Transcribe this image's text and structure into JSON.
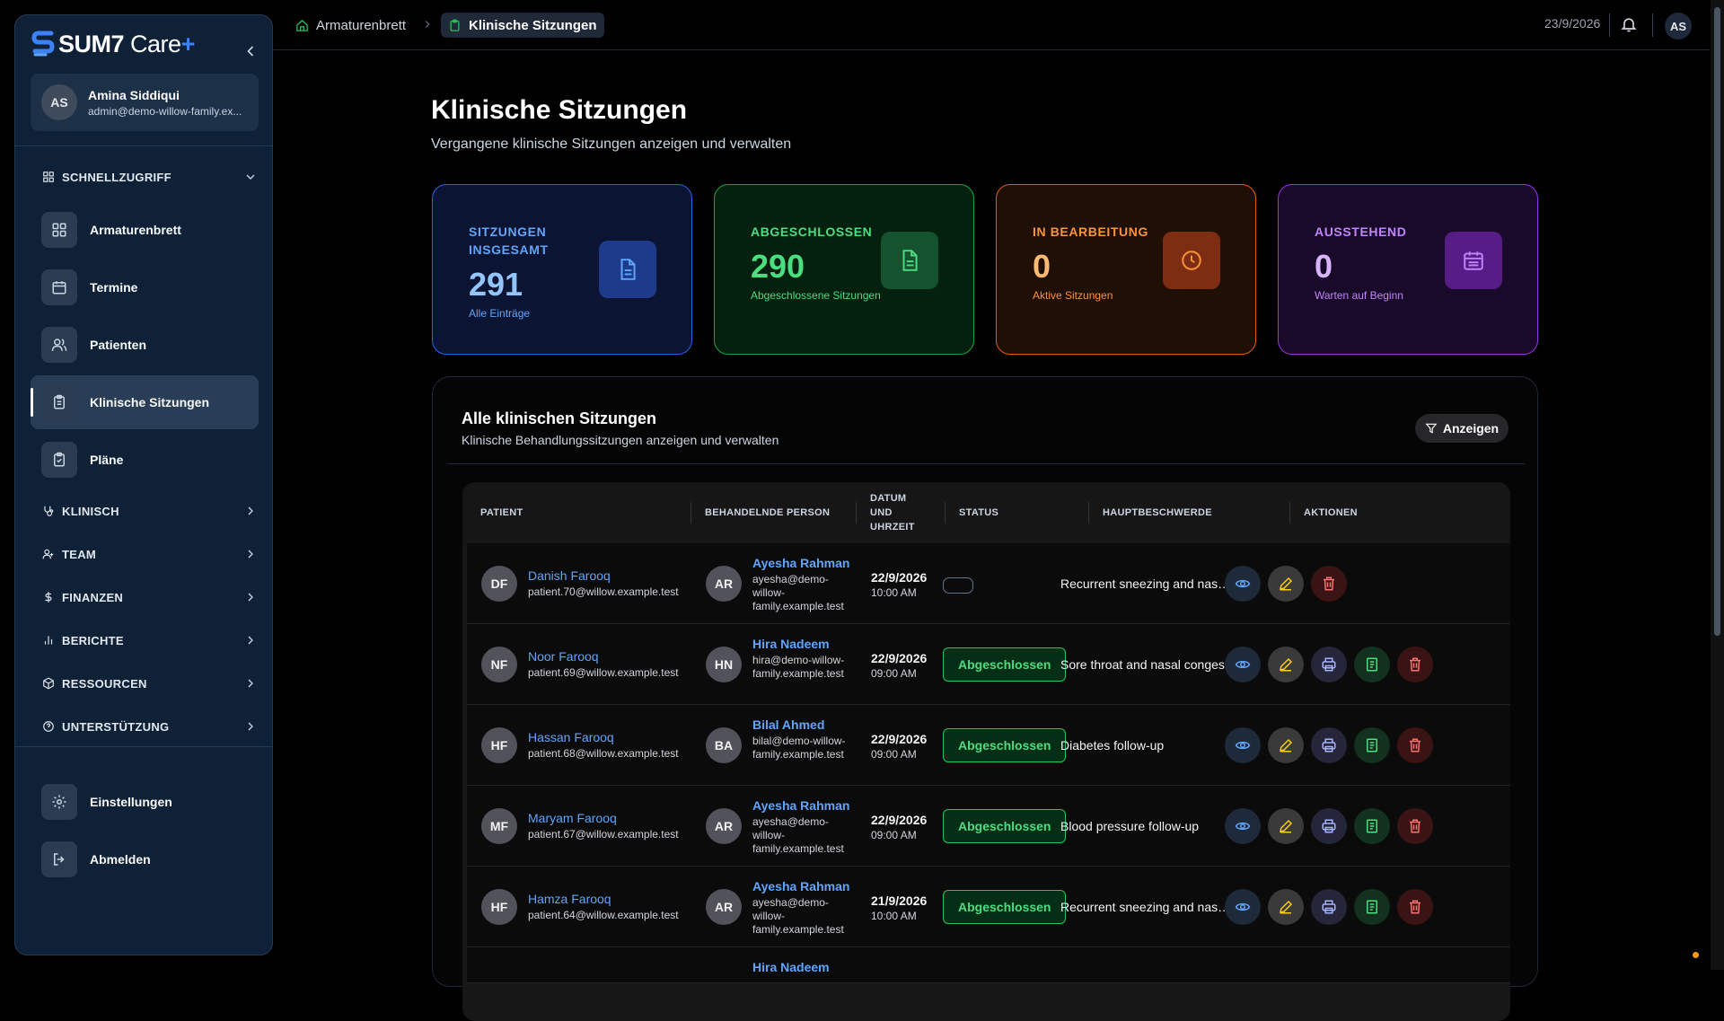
{
  "app": {
    "brand_name": "SUM7",
    "brand_suffix": "Care",
    "brand_plus": "+"
  },
  "user": {
    "initials": "AS",
    "name": "Amina Siddiqui",
    "email": "admin@demo-willow-family.ex..."
  },
  "sidebar": {
    "quick_access_label": "SCHNELLZUGRIFF",
    "items": [
      {
        "label": "Armaturenbrett",
        "icon": "grid-icon"
      },
      {
        "label": "Termine",
        "icon": "calendar-icon"
      },
      {
        "label": "Patienten",
        "icon": "users-icon"
      },
      {
        "label": "Klinische Sitzungen",
        "icon": "clipboard-icon",
        "active": true
      },
      {
        "label": "Pläne",
        "icon": "clipboard-check-icon"
      }
    ],
    "sections": [
      {
        "label": "KLINISCH",
        "icon": "stethoscope-icon"
      },
      {
        "label": "TEAM",
        "icon": "user-group-icon"
      },
      {
        "label": "FINANZEN",
        "icon": "dollar-icon"
      },
      {
        "label": "BERICHTE",
        "icon": "bar-chart-icon"
      },
      {
        "label": "RESSOURCEN",
        "icon": "package-icon"
      },
      {
        "label": "UNTERSTÜTZUNG",
        "icon": "help-circle-icon"
      }
    ],
    "bottom": [
      {
        "label": "Einstellungen",
        "icon": "gear-icon"
      },
      {
        "label": "Abmelden",
        "icon": "logout-icon"
      }
    ]
  },
  "topbar": {
    "breadcrumb": [
      "Armaturenbrett",
      "Klinische Sitzungen"
    ],
    "date": "23/9/2026",
    "avatar_initials": "AS"
  },
  "page": {
    "title": "Klinische Sitzungen",
    "subtitle": "Vergangene klinische Sitzungen anzeigen und verwalten"
  },
  "stats": [
    {
      "label": "SITZUNGEN INSGESAMT",
      "value": "291",
      "sub": "Alle Einträge",
      "color": "#60a5fa"
    },
    {
      "label": "ABGESCHLOSSEN",
      "value": "290",
      "sub": "Abgeschlossene Sitzungen",
      "color": "#4ade80"
    },
    {
      "label": "IN BEARBEITUNG",
      "value": "0",
      "sub": "Aktive Sitzungen",
      "color": "#fb923c"
    },
    {
      "label": "AUSSTEHEND",
      "value": "0",
      "sub": "Warten auf Beginn",
      "color": "#c084fc"
    }
  ],
  "table": {
    "title": "Alle klinischen Sitzungen",
    "subtitle": "Klinische Behandlungssitzungen anzeigen und verwalten",
    "filter_label": "Anzeigen",
    "columns": [
      "PATIENT",
      "BEHANDELNDE PERSON",
      "DATUM UND UHRZEIT",
      "STATUS",
      "HAUPTBESCHWERDE",
      "AKTIONEN"
    ],
    "rows": [
      {
        "p_initials": "DF",
        "p_name": "Danish Farooq",
        "p_email": "patient.70@willow.example.test",
        "c_initials": "AR",
        "c_name": "Ayesha Rahman",
        "c_email": "ayesha@demo-willow-family.example.test",
        "date": "22/9/2026",
        "time": "10:00 AM",
        "status": "",
        "complaint": "Recurrent sneezing and nasal..."
      },
      {
        "p_initials": "NF",
        "p_name": "Noor Farooq",
        "p_email": "patient.69@willow.example.test",
        "c_initials": "HN",
        "c_name": "Hira Nadeem",
        "c_email": "hira@demo-willow-family.example.test",
        "date": "22/9/2026",
        "time": "09:00 AM",
        "status": "Abgeschlossen",
        "complaint": "Sore throat and nasal conges..."
      },
      {
        "p_initials": "HF",
        "p_name": "Hassan Farooq",
        "p_email": "patient.68@willow.example.test",
        "c_initials": "BA",
        "c_name": "Bilal Ahmed",
        "c_email": "bilal@demo-willow-family.example.test",
        "date": "22/9/2026",
        "time": "09:00 AM",
        "status": "Abgeschlossen",
        "complaint": "Diabetes follow-up"
      },
      {
        "p_initials": "MF",
        "p_name": "Maryam Farooq",
        "p_email": "patient.67@willow.example.test",
        "c_initials": "AR",
        "c_name": "Ayesha Rahman",
        "c_email": "ayesha@demo-willow-family.example.test",
        "date": "22/9/2026",
        "time": "09:00 AM",
        "status": "Abgeschlossen",
        "complaint": "Blood pressure follow-up"
      },
      {
        "p_initials": "HF",
        "p_name": "Hamza Farooq",
        "p_email": "patient.64@willow.example.test",
        "c_initials": "AR",
        "c_name": "Ayesha Rahman",
        "c_email": "ayesha@demo-willow-family.example.test",
        "date": "21/9/2026",
        "time": "10:00 AM",
        "status": "Abgeschlossen",
        "complaint": "Recurrent sneezing and nasal..."
      },
      {
        "c_name": "Hira Nadeem"
      }
    ]
  }
}
